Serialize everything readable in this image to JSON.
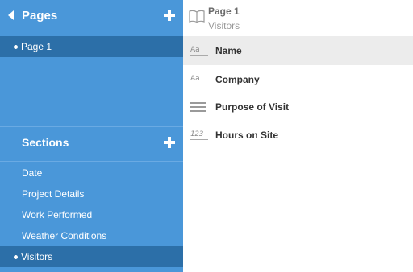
{
  "sidebar": {
    "pages": {
      "title": "Pages",
      "items": [
        {
          "label": "Page 1",
          "active": true
        }
      ]
    },
    "sections": {
      "title": "Sections",
      "items": [
        {
          "label": "Date",
          "active": false
        },
        {
          "label": "Project Details",
          "active": false
        },
        {
          "label": "Work Performed",
          "active": false
        },
        {
          "label": "Weather Conditions",
          "active": false
        },
        {
          "label": "Visitors",
          "active": true
        }
      ]
    },
    "colors": {
      "background": "#4a97d9",
      "active": "#2c6fa8"
    }
  },
  "main": {
    "breadcrumb": {
      "title": "Page 1",
      "subtitle": "Visitors",
      "icon": "book-icon"
    },
    "fields": [
      {
        "label": "Name",
        "icon": "text-field-icon",
        "icon_text": "Aa",
        "selected": true
      },
      {
        "label": "Company",
        "icon": "text-field-icon",
        "icon_text": "Aa",
        "selected": false
      },
      {
        "label": "Purpose of Visit",
        "icon": "multiline-field-icon",
        "icon_text": "",
        "selected": false
      },
      {
        "label": "Hours on Site",
        "icon": "number-field-icon",
        "icon_text": "123",
        "selected": false
      }
    ]
  }
}
